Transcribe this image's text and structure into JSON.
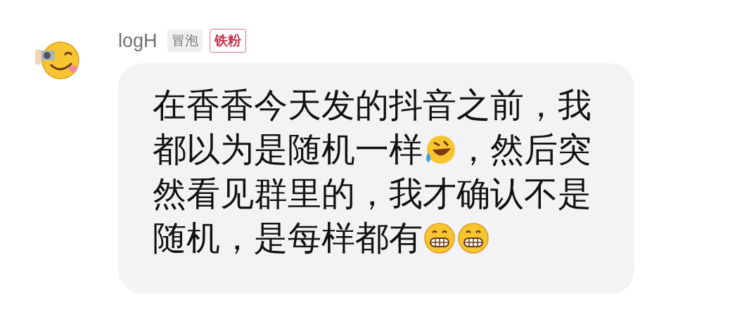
{
  "comment": {
    "author": "logH",
    "badges": [
      {
        "kind": "plain",
        "text": "冒泡"
      },
      {
        "kind": "fan",
        "text": "铁粉"
      }
    ],
    "message_lines": [
      [
        {
          "kind": "text",
          "text": "在香香今天发的抖音之前，我"
        }
      ],
      [
        {
          "kind": "text",
          "text": "都以为是随机一样"
        },
        {
          "kind": "laugh"
        },
        {
          "kind": "text",
          "text": "，然后突"
        }
      ],
      [
        {
          "kind": "text",
          "text": "然看见群里的，我才确认不是"
        }
      ],
      [
        {
          "kind": "text",
          "text": "随机，是每样都有"
        },
        {
          "kind": "grin"
        },
        {
          "kind": "grin"
        }
      ]
    ]
  }
}
